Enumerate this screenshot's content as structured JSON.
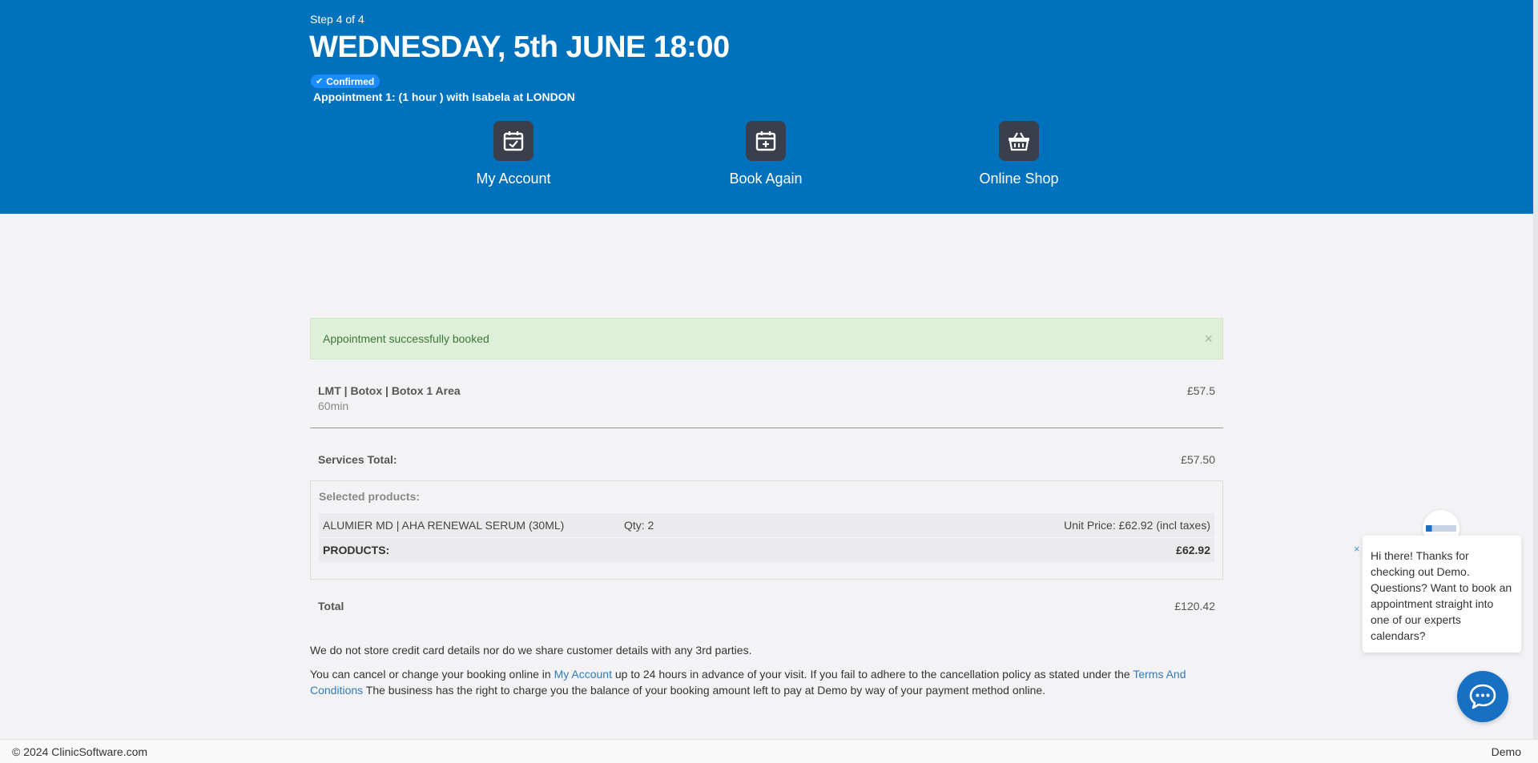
{
  "header": {
    "step": "Step 4 of 4",
    "title": "WEDNESDAY, 5th JUNE 18:00",
    "badge": "Confirmed",
    "appointment": "Appointment 1:   (1 hour ) with Isabela at LONDON"
  },
  "nav": [
    {
      "label": "My Account",
      "icon": "calendar-check-icon"
    },
    {
      "label": "Book Again",
      "icon": "calendar-plus-icon"
    },
    {
      "label": "Online Shop",
      "icon": "shopping-basket-icon"
    }
  ],
  "alert": {
    "message": "Appointment successfully booked",
    "close": "×"
  },
  "service": {
    "name": "LMT | Botox | Botox 1 Area",
    "duration": "60min",
    "price": "£57.5"
  },
  "services_total": {
    "label": "Services Total:",
    "value": "£57.50"
  },
  "products": {
    "header": "Selected products:",
    "items": [
      {
        "name": "ALUMIER MD | AHA RENEWAL SERUM (30ML)",
        "qty": "Qty: 2",
        "unit_price": "Unit Price: £62.92 (incl taxes)"
      }
    ],
    "total_label": "PRODUCTS:",
    "total_value": "£62.92"
  },
  "total": {
    "label": "Total",
    "value": "£120.42"
  },
  "notes": {
    "privacy": "We do not store credit card details nor do we share customer details with any 3rd parties.",
    "cancel_before": "You can cancel or change your booking online in ",
    "cancel_link": "My Account",
    "cancel_middle": " up to 24 hours in advance of your visit. If you fail to adhere to the cancellation policy as stated under the ",
    "terms_link": "Terms And Conditions",
    "cancel_after": " The business has the right to charge you the balance of your booking amount left to pay at Demo by way of your payment method online."
  },
  "footer": {
    "copyright": "© 2024 ClinicSoftware.com",
    "business": "Demo"
  },
  "chat": {
    "close": "×",
    "message": "Hi there! Thanks for checking out Demo. Questions? Want to book an appointment straight into one of our experts calendars?"
  },
  "colors": {
    "header": "#0072bd",
    "badge": "#1a8cff",
    "icon_tile": "#3a3f4b",
    "alert_bg": "#dff0d8",
    "link": "#337ab7",
    "chat_button": "#1870c5"
  }
}
